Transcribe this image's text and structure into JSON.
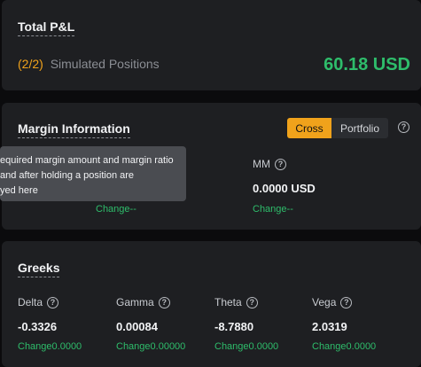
{
  "pnl": {
    "title": "Total P&L",
    "count": "(2/2)",
    "label": "Simulated Positions",
    "value": "60.18 USD"
  },
  "margin": {
    "title": "Margin Information",
    "toggle": {
      "cross": "Cross",
      "portfolio": "Portfolio"
    },
    "mm_label": "MM",
    "mm_value": "0.0000 USD",
    "change_left": "Change--",
    "change_right": "Change--",
    "tooltip_lines": [
      "equired margin amount and margin ratio",
      " and after holding a position are",
      "yed here"
    ]
  },
  "greeks": {
    "title": "Greeks",
    "items": [
      {
        "label": "Delta",
        "value": "-0.3326",
        "change": "Change0.0000"
      },
      {
        "label": "Gamma",
        "value": "0.00084",
        "change": "Change0.00000"
      },
      {
        "label": "Theta",
        "value": "-8.7880",
        "change": "Change0.0000"
      },
      {
        "label": "Vega",
        "value": "2.0319",
        "change": "Change0.0000"
      }
    ]
  },
  "icons": {
    "help": "question-circle-icon",
    "help_glyph": "?"
  },
  "colors": {
    "accent": "#f0a21b",
    "positive": "#2ebd6b",
    "card": "#1e1f22"
  }
}
